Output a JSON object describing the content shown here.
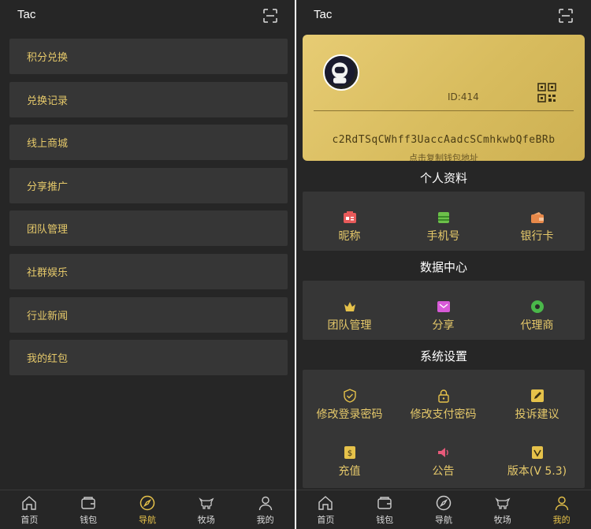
{
  "left": {
    "title": "Tac",
    "menu": [
      "积分兑换",
      "兑换记录",
      "线上商城",
      "分享推广",
      "团队管理",
      "社群娱乐",
      "行业新闻",
      "我的红包"
    ],
    "nav": [
      "首页",
      "钱包",
      "导航",
      "牧场",
      "我的"
    ],
    "active_nav": "导航"
  },
  "right": {
    "title": "Tac",
    "card": {
      "id": "ID:414",
      "address": "c2RdTSqCWhff3UaccAadcSCmhkwbQfeBRb",
      "hint": "点击复制钱包地址"
    },
    "sections": {
      "profile": {
        "title": "个人资料",
        "items": [
          {
            "label": "昵称",
            "icon": "id-card-icon",
            "color": "#e85a5a"
          },
          {
            "label": "手机号",
            "icon": "phone-icon",
            "color": "#6cc04a"
          },
          {
            "label": "银行卡",
            "icon": "bank-card-icon",
            "color": "#e8894a"
          }
        ]
      },
      "data": {
        "title": "数据中心",
        "items": [
          {
            "label": "团队管理",
            "icon": "crown-icon",
            "color": "#e6c24a"
          },
          {
            "label": "分享",
            "icon": "share-icon",
            "color": "#d85ad8"
          },
          {
            "label": "代理商",
            "icon": "agent-icon",
            "color": "#4ab84a"
          }
        ]
      },
      "settings": {
        "title": "系统设置",
        "items": [
          {
            "label": "修改登录密码",
            "icon": "shield-icon",
            "color": "#e6c24a"
          },
          {
            "label": "修改支付密码",
            "icon": "lock-icon",
            "color": "#e6c24a"
          },
          {
            "label": "投诉建议",
            "icon": "edit-icon",
            "color": "#e6c24a"
          },
          {
            "label": "充值",
            "icon": "wallet-icon",
            "color": "#e6c24a"
          },
          {
            "label": "公告",
            "icon": "speaker-icon",
            "color": "#e85a7a"
          },
          {
            "label": "版本(V 5.3)",
            "icon": "version-icon",
            "color": "#e6c24a"
          }
        ]
      }
    },
    "nav": [
      "首页",
      "钱包",
      "导航",
      "牧场",
      "我的"
    ],
    "active_nav": "我的"
  }
}
